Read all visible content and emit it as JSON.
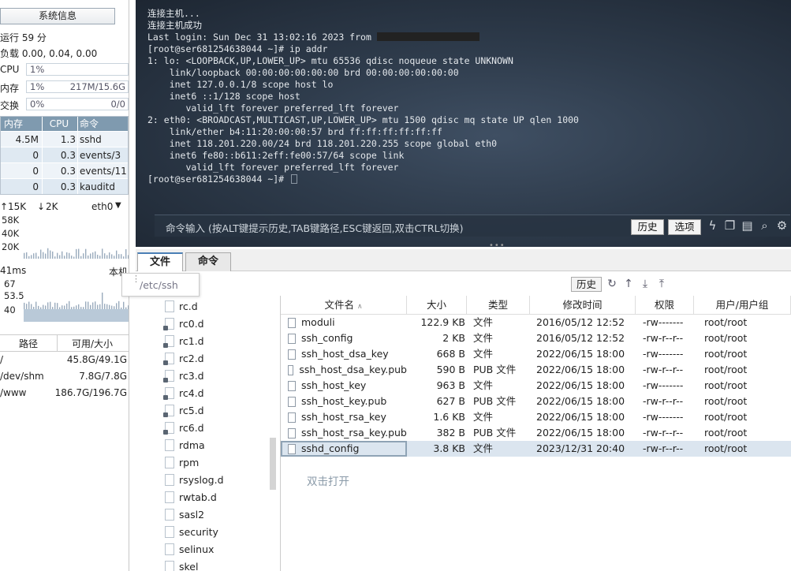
{
  "left": {
    "sysinfo_button": "系统信息",
    "uptime": "运行 59 分",
    "load": "负载 0.00, 0.04, 0.00",
    "cpu": {
      "label": "CPU",
      "left": "1%",
      "right": ""
    },
    "mem": {
      "label": "内存",
      "left": "1%",
      "right": "217M/15.6G"
    },
    "swap": {
      "label": "交换",
      "left": "0%",
      "right": "0/0"
    },
    "proc_headers": [
      "内存",
      "CPU",
      "命令"
    ],
    "processes": [
      {
        "mem": "4.5M",
        "cpu": "1.3",
        "cmd": "sshd"
      },
      {
        "mem": "0",
        "cpu": "0.3",
        "cmd": "events/3"
      },
      {
        "mem": "0",
        "cpu": "0.3",
        "cmd": "events/11"
      },
      {
        "mem": "0",
        "cpu": "0.3",
        "cmd": "kauditd"
      }
    ],
    "net": {
      "up": "15K",
      "down": "2K",
      "iface": "eth0",
      "scale": [
        "58K",
        "40K",
        "20K"
      ]
    },
    "ping": {
      "ms": "41ms",
      "host": "本机",
      "scale": [
        "67",
        "53.5",
        "40"
      ]
    },
    "disk_headers": [
      "路径",
      "可用/大小"
    ],
    "disks": [
      {
        "path": "/",
        "size": "45.8G/49.1G"
      },
      {
        "path": "/dev/shm",
        "size": "7.8G/7.8G"
      },
      {
        "path": "/www",
        "size": "186.7G/196.7G"
      }
    ]
  },
  "terminal": {
    "lines": [
      "连接主机...",
      "连接主机成功",
      "Last login: Sun Dec 31 13:02:16 2023 from ",
      "[root@ser681254638044 ~]# ip addr",
      "1: lo: <LOOPBACK,UP,LOWER_UP> mtu 65536 qdisc noqueue state UNKNOWN",
      "    link/loopback 00:00:00:00:00:00 brd 00:00:00:00:00:00",
      "    inet 127.0.0.1/8 scope host lo",
      "    inet6 ::1/128 scope host",
      "       valid_lft forever preferred_lft forever",
      "2: eth0: <BROADCAST,MULTICAST,UP,LOWER_UP> mtu 1500 qdisc mq state UP qlen 1000",
      "    link/ether b4:11:20:00:00:57 brd ff:ff:ff:ff:ff:ff",
      "    inet 118.201.220.00/24 brd 118.201.220.255 scope global eth0",
      "    inet6 fe80::b611:2eff:fe00:57/64 scope link",
      "       valid_lft forever preferred_lft forever",
      "[root@ser681254638044 ~]# "
    ],
    "cmd_hint": "命令输入 (按ALT键提示历史,TAB键路径,ESC键返回,双击CTRL切换)",
    "history_btn": "历史",
    "options_btn": "选项"
  },
  "tabs": {
    "files": "文件",
    "commands": "命令"
  },
  "path": "/etc/ssh",
  "history_btn2": "历史",
  "tree": [
    "rc.d",
    "rc0.d",
    "rc1.d",
    "rc2.d",
    "rc3.d",
    "rc4.d",
    "rc5.d",
    "rc6.d",
    "rdma",
    "rpm",
    "rsyslog.d",
    "rwtab.d",
    "sasl2",
    "security",
    "selinux",
    "skel"
  ],
  "file_headers": {
    "name": "文件名",
    "size": "大小",
    "type": "类型",
    "time": "修改时间",
    "perm": "权限",
    "owner": "用户/用户组"
  },
  "files": [
    {
      "name": "moduli",
      "size": "122.9 KB",
      "type": "文件",
      "time": "2016/05/12 12:52",
      "perm": "-rw-------",
      "owner": "root/root"
    },
    {
      "name": "ssh_config",
      "size": "2 KB",
      "type": "文件",
      "time": "2016/05/12 12:52",
      "perm": "-rw-r--r--",
      "owner": "root/root"
    },
    {
      "name": "ssh_host_dsa_key",
      "size": "668 B",
      "type": "文件",
      "time": "2022/06/15 18:00",
      "perm": "-rw-------",
      "owner": "root/root"
    },
    {
      "name": "ssh_host_dsa_key.pub",
      "size": "590 B",
      "type": "PUB 文件",
      "time": "2022/06/15 18:00",
      "perm": "-rw-r--r--",
      "owner": "root/root"
    },
    {
      "name": "ssh_host_key",
      "size": "963 B",
      "type": "文件",
      "time": "2022/06/15 18:00",
      "perm": "-rw-------",
      "owner": "root/root"
    },
    {
      "name": "ssh_host_key.pub",
      "size": "627 B",
      "type": "PUB 文件",
      "time": "2022/06/15 18:00",
      "perm": "-rw-r--r--",
      "owner": "root/root"
    },
    {
      "name": "ssh_host_rsa_key",
      "size": "1.6 KB",
      "type": "文件",
      "time": "2022/06/15 18:00",
      "perm": "-rw-------",
      "owner": "root/root"
    },
    {
      "name": "ssh_host_rsa_key.pub",
      "size": "382 B",
      "type": "PUB 文件",
      "time": "2022/06/15 18:00",
      "perm": "-rw-r--r--",
      "owner": "root/root"
    },
    {
      "name": "sshd_config",
      "size": "3.8 KB",
      "type": "文件",
      "time": "2023/12/31 20:40",
      "perm": "-rw-r--r--",
      "owner": "root/root"
    }
  ],
  "tooltip": "双击打开"
}
